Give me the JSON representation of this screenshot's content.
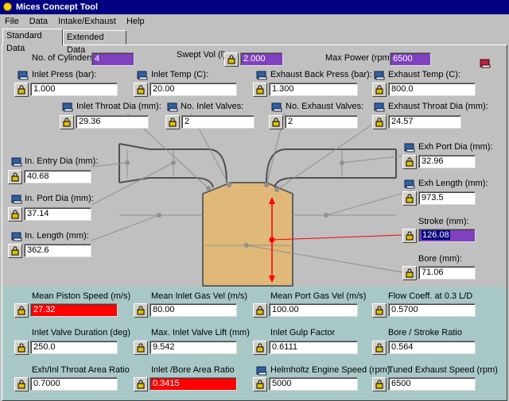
{
  "window": {
    "title": "Mices Concept Tool"
  },
  "menu": [
    "File",
    "Data",
    "Intake/Exhaust",
    "Help"
  ],
  "tabs": [
    "Standard Data",
    "Extended Data"
  ],
  "top": {
    "cylinders": {
      "label": "No. of Cylinders:",
      "value": "4"
    },
    "swept": {
      "label": "Swept Vol (l):",
      "value": "2.000"
    },
    "maxpower": {
      "label": "Max Power (rpm):",
      "value": "6500"
    }
  },
  "fields": {
    "inlet_press": {
      "label": "Inlet Press (bar):",
      "value": "1.000"
    },
    "inlet_temp": {
      "label": "Inlet Temp (C):",
      "value": "20.00"
    },
    "exh_back_press": {
      "label": "Exhaust Back Press (bar):",
      "value": "1.300"
    },
    "exh_temp": {
      "label": "Exhaust Temp (C):",
      "value": "800.0"
    },
    "inlet_throat_dia": {
      "label": "Inlet Throat Dia (mm):",
      "value": "29.36"
    },
    "inlet_valves": {
      "label": "No. Inlet Valves:",
      "value": "2"
    },
    "exh_valves": {
      "label": "No. Exhaust Valves:",
      "value": "2"
    },
    "exh_throat_dia": {
      "label": "Exhaust Throat Dia (mm):",
      "value": "24.57"
    },
    "in_entry_dia": {
      "label": "In. Entry Dia (mm):",
      "value": "40.68"
    },
    "in_port_dia": {
      "label": "In. Port Dia (mm):",
      "value": "37.14"
    },
    "in_length": {
      "label": "In. Length (mm):",
      "value": "362.6"
    },
    "exh_port_dia": {
      "label": "Exh Port Dia (mm):",
      "value": "32.96"
    },
    "exh_length": {
      "label": "Exh Length (mm):",
      "value": "973.5"
    },
    "stroke": {
      "label": "Stroke (mm):",
      "value": "126.08"
    },
    "bore": {
      "label": "Bore (mm):",
      "value": "71.06"
    }
  },
  "results": {
    "mean_piston_speed": {
      "label": "Mean Piston Speed (m/s)",
      "value": "27.32"
    },
    "mean_inlet_gas_vel": {
      "label": "Mean Inlet Gas Vel (m/s)",
      "value": "80.00"
    },
    "mean_port_gas_vel": {
      "label": "Mean Port Gas Vel (m/s)",
      "value": "100.00"
    },
    "flow_coeff": {
      "label": "Flow Coeff. at 0.3 L/D",
      "value": "0.5700"
    },
    "inlet_valve_duration": {
      "label": "Inlet Valve Duration (deg)",
      "value": "250.0"
    },
    "max_inlet_valve_lift": {
      "label": "Max. Inlet Valve Lift (mm)",
      "value": "9.542"
    },
    "inlet_gulp": {
      "label": "Inlet Gulp Factor",
      "value": "0.6111"
    },
    "bore_stroke": {
      "label": "Bore / Stroke Ratio",
      "value": "0.564"
    },
    "exh_inl_throat": {
      "label": "Exh/Inl Throat Area Ratio",
      "value": "0.7000"
    },
    "inlet_bore_area": {
      "label": "Inlet /Bore Area Ratio",
      "value": "0.3415"
    },
    "helmholtz": {
      "label": "Helmholtz Engine Speed (rpm)",
      "value": "5000"
    },
    "tuned_exhaust": {
      "label": "Tuned Exhaust Speed (rpm)",
      "value": "6500"
    }
  },
  "colors": {
    "warning": "#ff0000",
    "computed": "#8040c0",
    "bottom_panel": "#a8c8c8",
    "cylinder": "#e0b878"
  },
  "icons": {
    "lock": "padlock-icon",
    "book": "book-icon"
  }
}
